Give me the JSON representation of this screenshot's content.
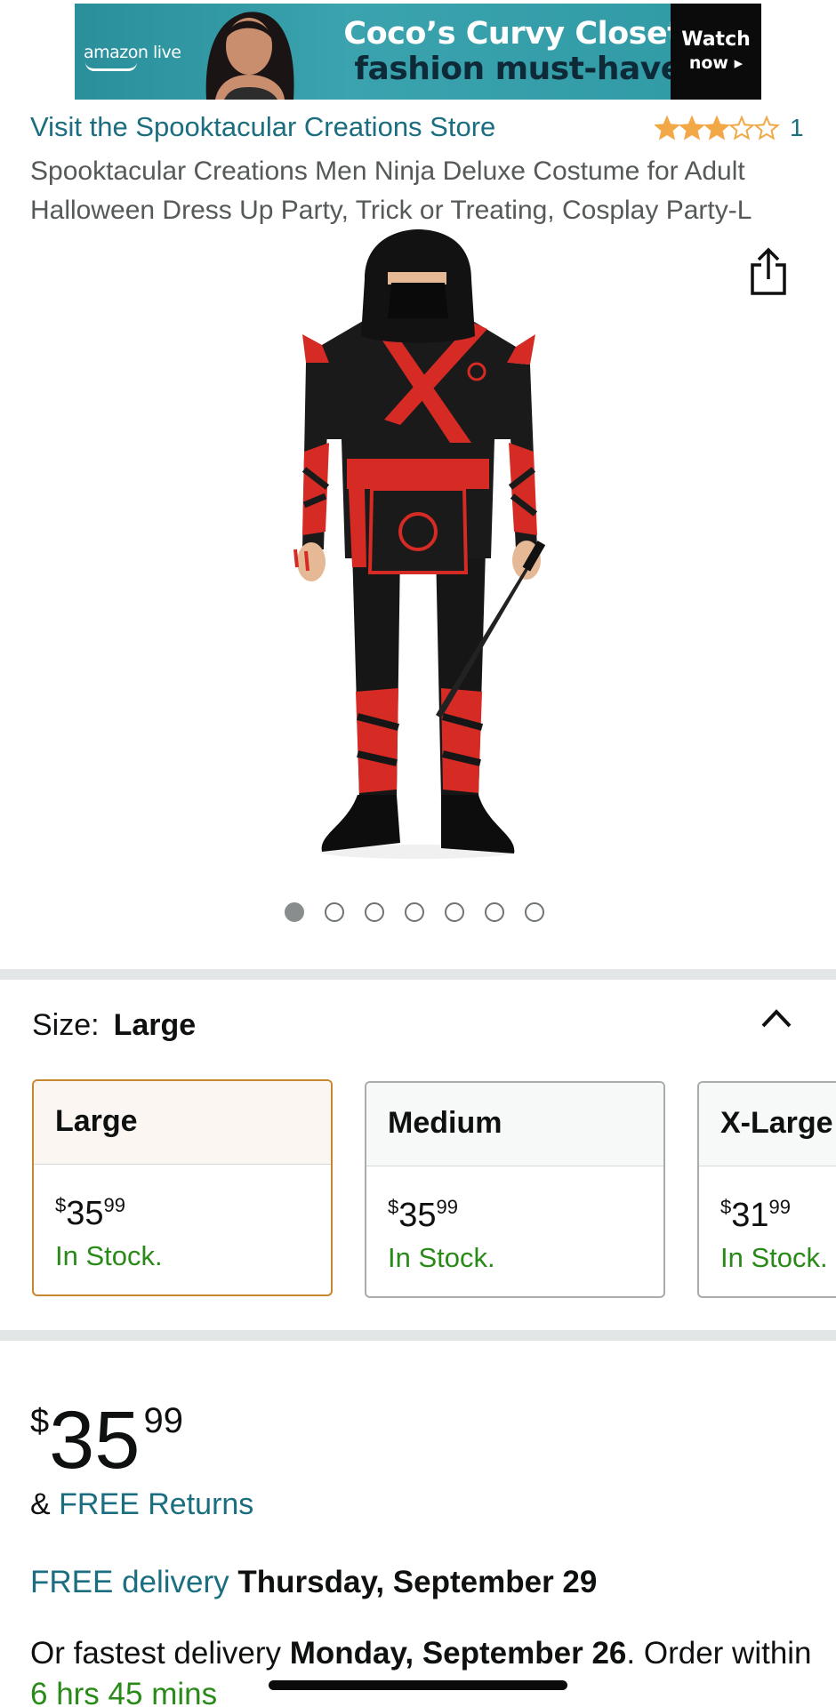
{
  "banner": {
    "logo": "amazon live",
    "headline_line1": "Coco’s Curvy Closet’s",
    "headline_line2": "fashion must-haves",
    "watch": "Watch",
    "now": "now ▸"
  },
  "store": {
    "link": "Visit the Spooktacular Creations Store",
    "rating_stars": 3,
    "rating_max": 5,
    "rating_count": "1"
  },
  "product": {
    "title": "Spooktacular Creations Men Ninja Deluxe Costume for Adult Halloween Dress Up Party, Trick or Treating, Cosplay Party-L",
    "image_count": 7,
    "active_image": 1
  },
  "size": {
    "label": "Size:",
    "selected": "Large",
    "options": [
      {
        "name": "Large",
        "currency": "$",
        "dollars": "35",
        "cents": "99",
        "stock": "In Stock."
      },
      {
        "name": "Medium",
        "currency": "$",
        "dollars": "35",
        "cents": "99",
        "stock": "In Stock."
      },
      {
        "name": "X-Large",
        "currency": "$",
        "dollars": "31",
        "cents": "99",
        "stock": "In Stock."
      }
    ]
  },
  "price": {
    "currency": "$",
    "dollars": "35",
    "cents": "99"
  },
  "returns": {
    "prefix": "& ",
    "link": "FREE Returns"
  },
  "delivery": {
    "label": "FREE delivery",
    "date": "Thursday, September 29"
  },
  "fastest": {
    "prefix": "Or fastest delivery ",
    "date": "Monday, September 26",
    "middle": ". Order within ",
    "countdown": "6 hrs 45 mins"
  },
  "colors": {
    "accent": "#1a6e80",
    "stock_green": "#2a8a18",
    "selected_border": "#c7872e",
    "star": "#f3a847"
  }
}
